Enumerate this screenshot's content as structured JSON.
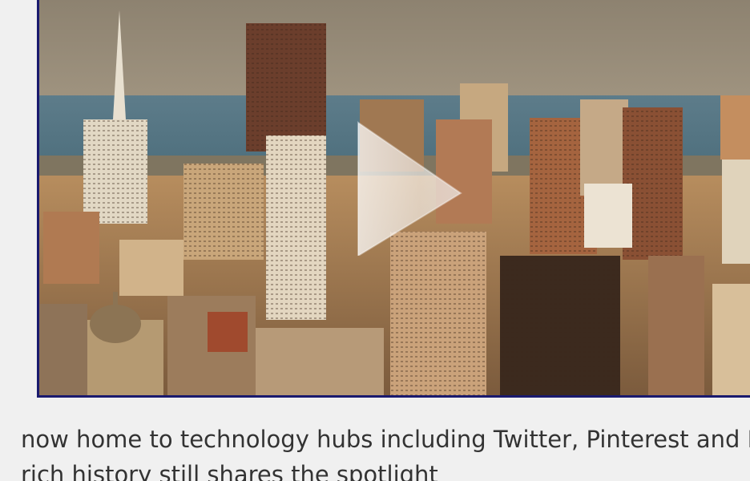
{
  "video": {
    "thumbnail_subject": "San Francisco skyline",
    "play_icon": "play-icon"
  },
  "article": {
    "line1": "now home to technology hubs including Twitter, Pinterest and R",
    "line2": "rich history still shares the spotlight"
  },
  "colors": {
    "frame_border": "#1a1a6e",
    "page_background": "#f0f0f0",
    "text": "#333333"
  }
}
